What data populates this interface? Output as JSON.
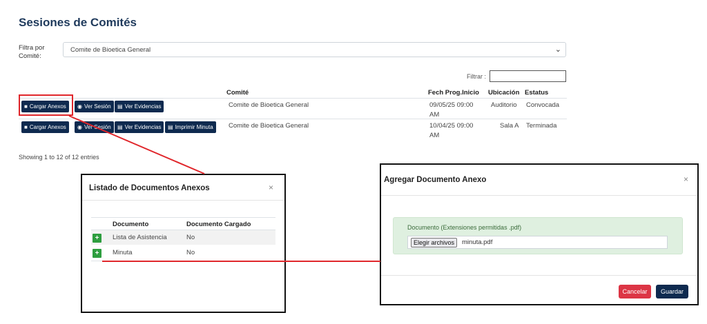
{
  "page": {
    "title": "Sesiones de Comités"
  },
  "filter": {
    "label": "Filtra por Comité:",
    "selected": "Comite de Bioetica General",
    "search_label": "Filtrar :"
  },
  "table": {
    "columns": [
      "Comité",
      "Fech Prog.Inicio",
      "Ubicación",
      "Estatus"
    ],
    "rows": [
      {
        "actions": [
          "Cargar Anexos",
          "Ver Sesión",
          "Ver Evidencias"
        ],
        "comite": "Comite de Bioetica General",
        "fecha_line1": "09/05/25 09:00",
        "fecha_line2": "AM",
        "ubicacion": "Auditorio",
        "estatus": "Convocada"
      },
      {
        "actions": [
          "Cargar Anexos",
          "Ver Sesión",
          "Ver Evidencias",
          "Imprimir Minuta"
        ],
        "comite": "Comite de Bioetica General",
        "fecha_line1": "10/04/25 09:00",
        "fecha_line2": "AM",
        "ubicacion": "Sala A",
        "estatus": "Terminada"
      }
    ],
    "footer": "Showing 1 to 12 of 12 entries"
  },
  "modal_list": {
    "title": "Listado de Documentos Anexos",
    "close": "×",
    "columns": [
      "Documento",
      "Documento Cargado"
    ],
    "rows": [
      {
        "documento": "Lista de Asistencia",
        "cargado": "No"
      },
      {
        "documento": "Minuta",
        "cargado": "No"
      }
    ],
    "add_symbol": "+"
  },
  "modal_upload": {
    "title": "Agregar Documento Anexo",
    "close": "×",
    "field_label": "Documento (Extensiones permitidas .pdf)",
    "file_button": "Elegir archivos",
    "file_name": "minuta.pdf",
    "cancel": "Cancelar",
    "save": "Guardar"
  },
  "icons": {
    "folder": "folder-icon",
    "eye": "eye-icon",
    "file": "file-icon",
    "print": "print-icon",
    "close": "close-icon",
    "chevron": "chevron-down-icon",
    "plus": "plus-icon"
  },
  "colors": {
    "primary": "#0e2a4f",
    "danger": "#dc3545",
    "success": "#2e9e3f",
    "highlight": "#e0262b"
  }
}
